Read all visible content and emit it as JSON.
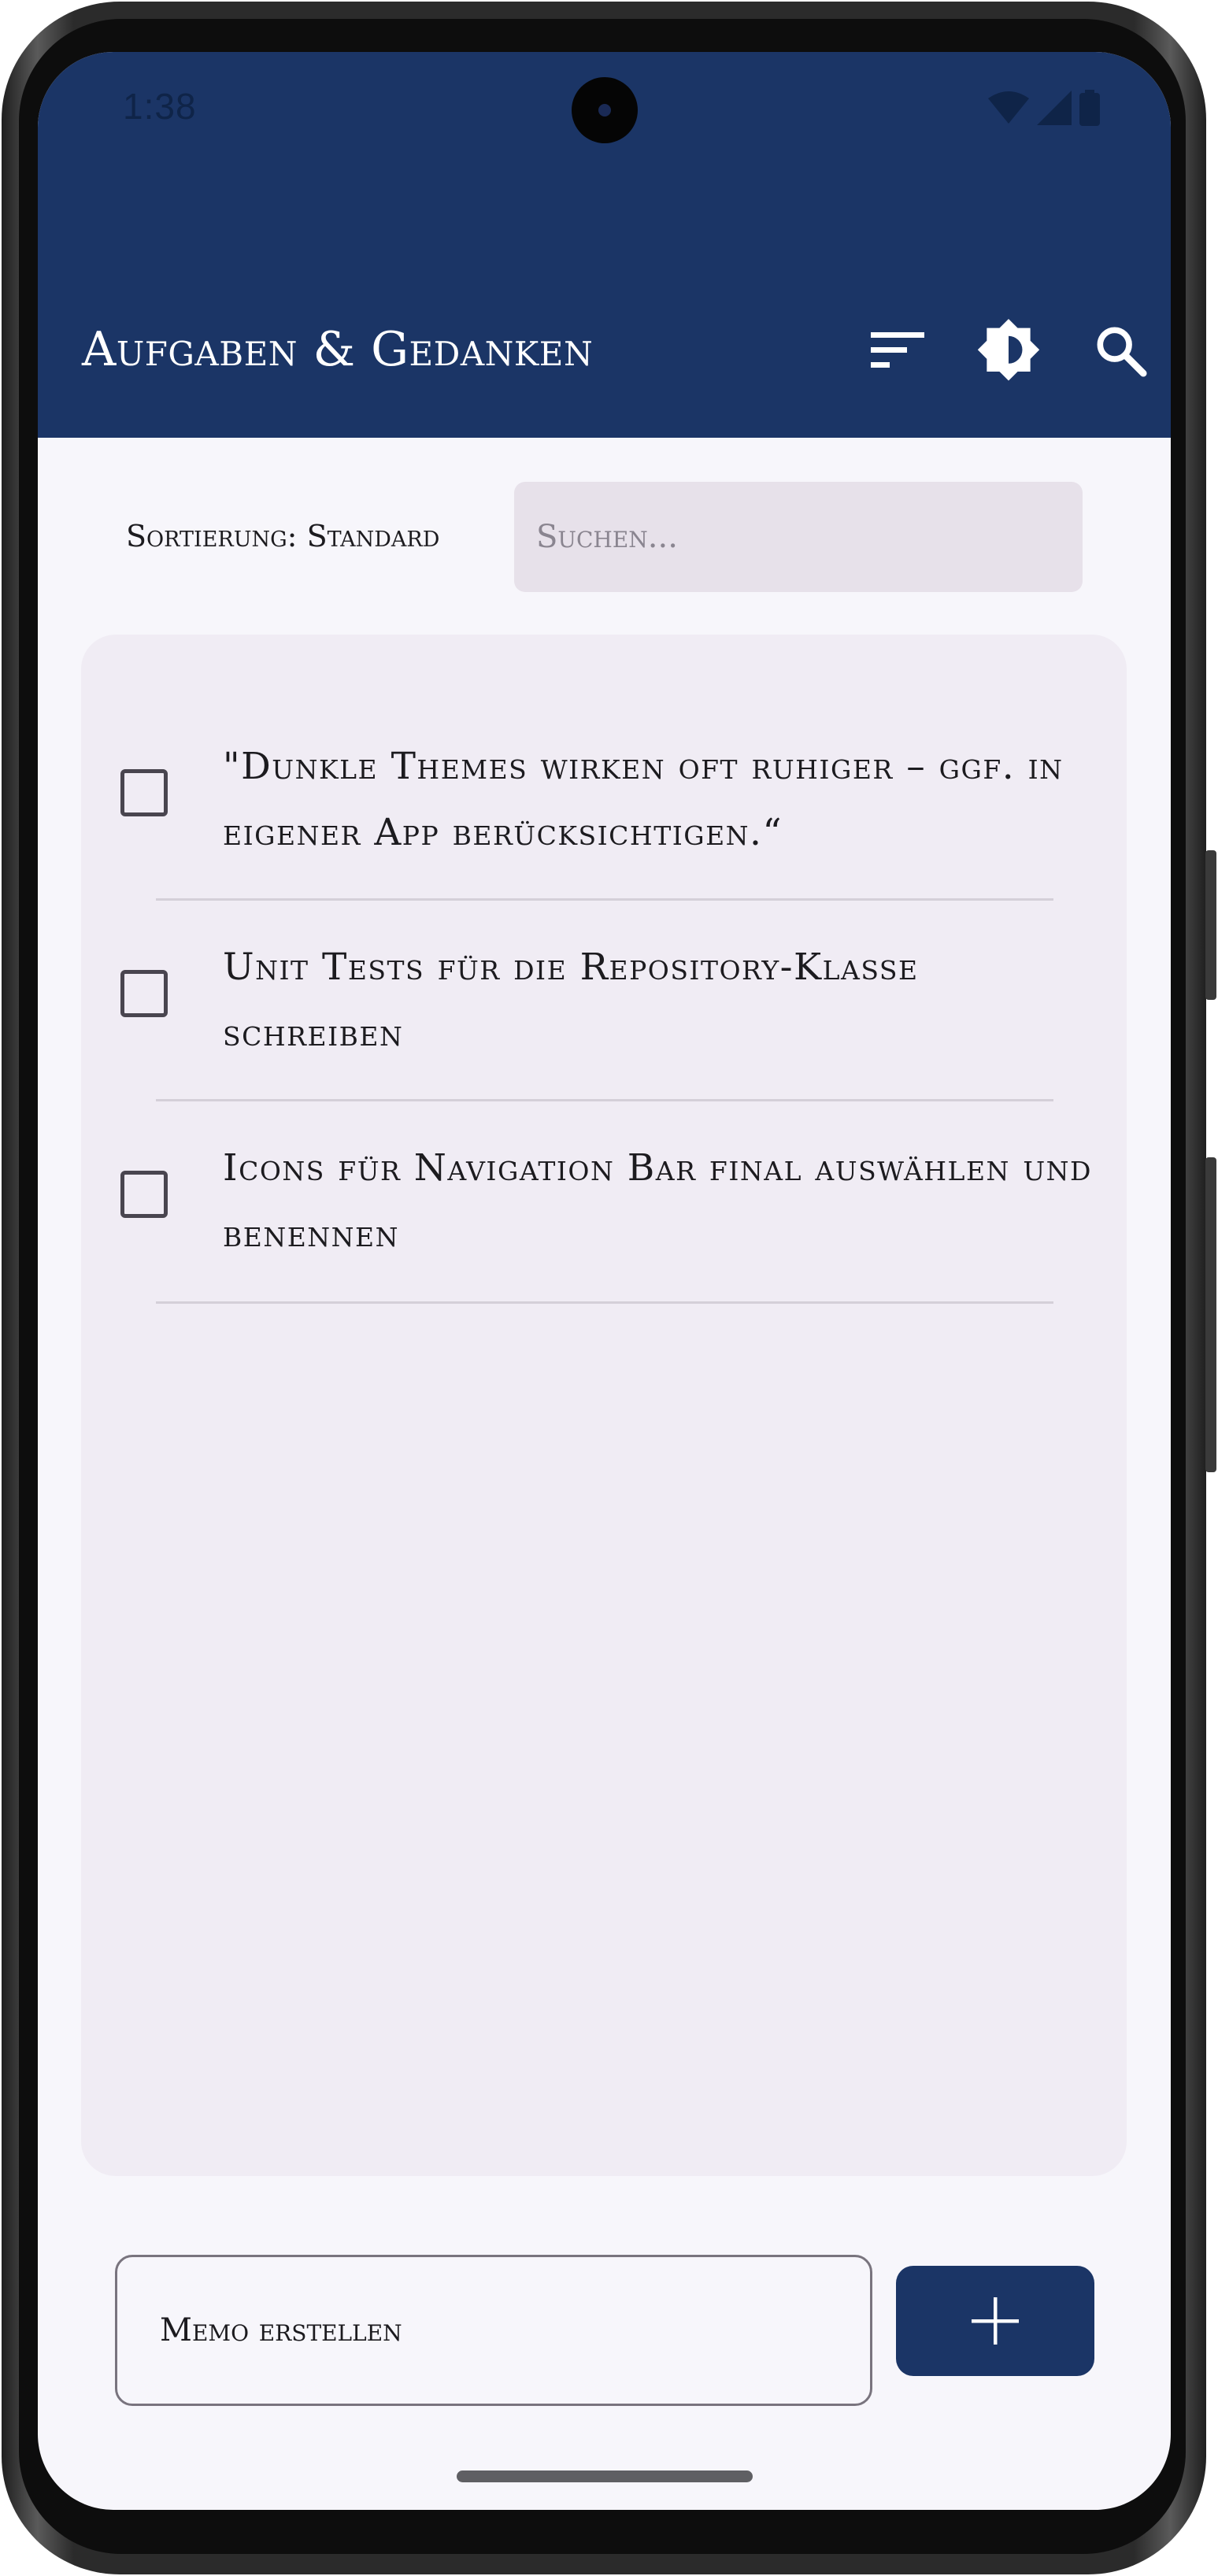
{
  "status_bar": {
    "time": "1:38"
  },
  "app_bar": {
    "title": "Aufgaben & Gedanken",
    "background_color": "#1b3566",
    "icons": [
      "sort-icon",
      "brightness-icon",
      "search-icon"
    ]
  },
  "controls": {
    "sort_label": "Sortierung: Standard",
    "search_placeholder": "Suchen..."
  },
  "list": {
    "items": [
      {
        "text": "\"Dunkle Themes wirken oft ruhiger – ggf. in eigener App berücksichtigen.“",
        "checked": false
      },
      {
        "text": "Unit Tests für die Repository-Klasse schreiben",
        "checked": false
      },
      {
        "text": "Icons für Navigation Bar final auswählen und benennen",
        "checked": false
      }
    ]
  },
  "bottom": {
    "memo_placeholder": "Memo erstellen",
    "add_icon": "plus-icon"
  }
}
